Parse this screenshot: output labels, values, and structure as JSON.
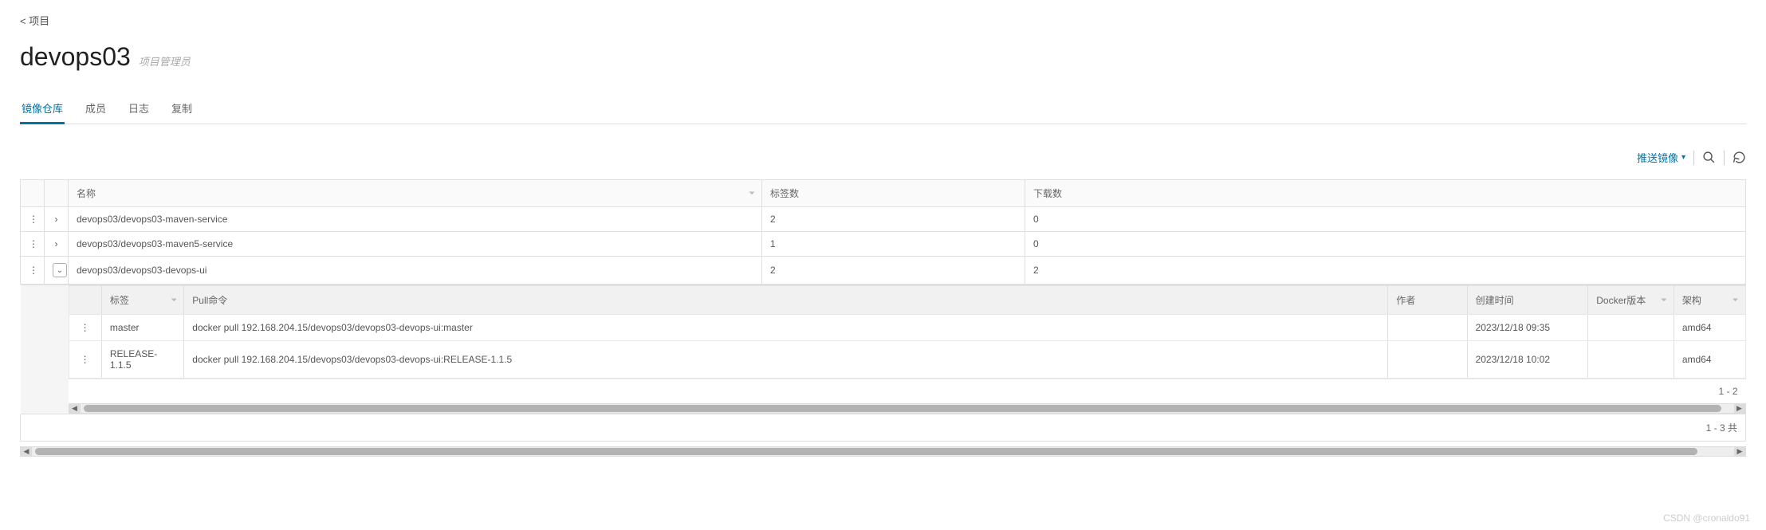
{
  "breadcrumb": {
    "back": "< 项目"
  },
  "header": {
    "title": "devops03",
    "subtitle": "项目管理员"
  },
  "tabs": [
    "镜像仓库",
    "成员",
    "日志",
    "复制"
  ],
  "active_tab_index": 0,
  "actions": {
    "push_image": "推送镜像"
  },
  "outer_columns": {
    "name": "名称",
    "tags": "标签数",
    "downloads": "下载数"
  },
  "repos": [
    {
      "name": "devops03/devops03-maven-service",
      "tags": "2",
      "downloads": "0",
      "expanded": false
    },
    {
      "name": "devops03/devops03-maven5-service",
      "tags": "1",
      "downloads": "0",
      "expanded": false
    },
    {
      "name": "devops03/devops03-devops-ui",
      "tags": "2",
      "downloads": "2",
      "expanded": true
    }
  ],
  "inner_columns": {
    "tag": "标签",
    "pull_cmd": "Pull命令",
    "author": "作者",
    "created": "创建时间",
    "docker_ver": "Docker版本",
    "arch": "架构"
  },
  "inner_rows": [
    {
      "tag": "master",
      "pull_cmd": "docker pull 192.168.204.15/devops03/devops03-devops-ui:master",
      "author": "",
      "created": "2023/12/18 09:35",
      "docker_ver": "",
      "arch": "amd64"
    },
    {
      "tag": "RELEASE-1.1.5",
      "pull_cmd": "docker pull 192.168.204.15/devops03/devops03-devops-ui:RELEASE-1.1.5",
      "author": "",
      "created": "2023/12/18 10:02",
      "docker_ver": "",
      "arch": "amd64"
    }
  ],
  "pagination": {
    "inner": "1 - 2",
    "outer": "1 - 3 共"
  },
  "watermark": "CSDN @cronaldo91"
}
